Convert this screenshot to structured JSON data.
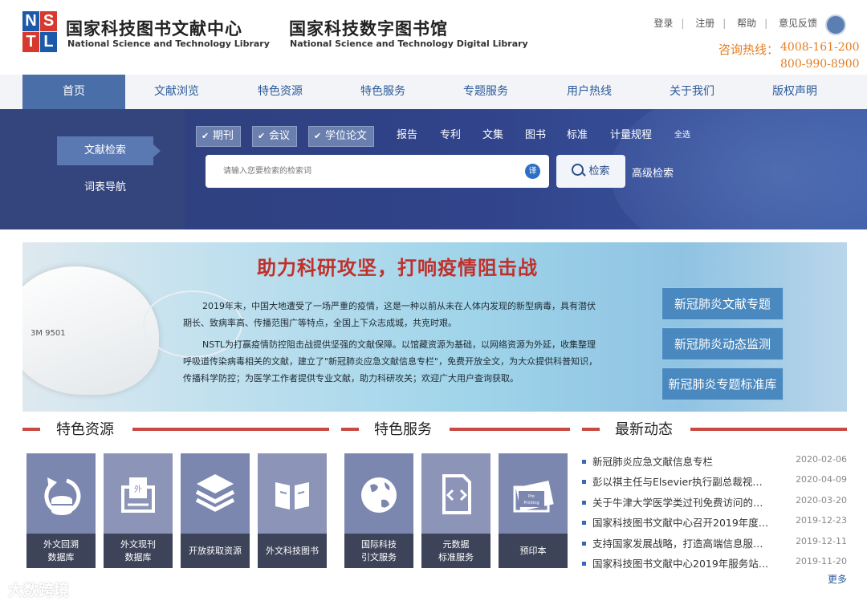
{
  "header": {
    "logo_letters": [
      "N",
      "S",
      "T",
      "L"
    ],
    "title1_cn": "国家科技图书文献中心",
    "title1_en": "National Science and Technology Library",
    "title2_cn": "国家科技数字图书馆",
    "title2_en": "National Science and Technology Digital Library",
    "links": [
      "登录",
      "注册",
      "帮助",
      "意见反馈"
    ],
    "hotline_label": "咨询热线：",
    "hotline_1": "4008-161-200",
    "hotline_2": "800-990-8900",
    "colors": {
      "hotline": "#e67e22",
      "brand_blue": "#2b5a9a",
      "logo_red": "#d63a2f",
      "logo_blue": "#1b5aa8"
    }
  },
  "nav": {
    "items": [
      "首页",
      "文献浏览",
      "特色资源",
      "特色服务",
      "专题服务",
      "用户热线",
      "关于我们",
      "版权声明"
    ],
    "active_index": 0
  },
  "search": {
    "tabs": [
      "文献检索",
      "词表导航"
    ],
    "categories": [
      {
        "label": "期刊",
        "checked": true
      },
      {
        "label": "会议",
        "checked": true
      },
      {
        "label": "学位论文",
        "checked": true
      },
      {
        "label": "报告",
        "checked": false
      },
      {
        "label": "专利",
        "checked": false
      },
      {
        "label": "文集",
        "checked": false
      },
      {
        "label": "图书",
        "checked": false
      },
      {
        "label": "标准",
        "checked": false
      },
      {
        "label": "计量规程",
        "checked": false
      }
    ],
    "select_all": "全选",
    "placeholder": "请输入您要检索的检索词",
    "translate_label": "译",
    "search_button": "检索",
    "advanced": "高级检索"
  },
  "banner": {
    "mask_text": "3M 9501",
    "title": "助力科研攻坚，打响疫情阻击战",
    "para1_line1": "2019年末，中国大地遭受了一场严重的疫情，这是一种以前从未在人体内发现的新型病毒，具有潜伏",
    "para1_line2": "期长、致病率高、传播范围广等特点，全国上下众志成城，共克时艰。",
    "para2_line1": "NSTL为打赢疫情防控阻击战提供坚强的文献保障。以馆藏资源为基础，以网络资源为外延，收集整理",
    "para2_line2": "呼吸道传染病毒相关的文献，建立了\"新冠肺炎应急文献信息专栏\"，免费开放全文，为大众提供科普知识，",
    "para2_line3": "传播科学防控；为医学工作者提供专业文献，助力科研攻关；欢迎广大用户查询获取。",
    "buttons": [
      "新冠肺炎文献专题",
      "新冠肺炎动态监测",
      "新冠肺炎专题标准库"
    ]
  },
  "sections": {
    "resources_title": "特色资源",
    "services_title": "特色服务",
    "news_title": "最新动态"
  },
  "resources": [
    {
      "label": "外文回溯\n数据库",
      "icon": "database-refresh-icon"
    },
    {
      "label": "外文现刊\n数据库",
      "icon": "foreign-journal-icon"
    },
    {
      "label": "开放获取资源",
      "icon": "layers-icon"
    },
    {
      "label": "外文科技图书",
      "icon": "open-book-icon"
    }
  ],
  "services": [
    {
      "label": "国际科技\n引文服务",
      "icon": "globe-icon"
    },
    {
      "label": "元数据\n标准服务",
      "icon": "code-file-icon"
    },
    {
      "label": "预印本",
      "icon": "preprint-icon"
    }
  ],
  "news": [
    {
      "title": "新冠肺炎应急文献信息专栏",
      "date": "2020-02-06"
    },
    {
      "title": "彭以祺主任与Elsevier执行副总裁视…",
      "date": "2020-04-09"
    },
    {
      "title": "关于牛津大学医学类过刊免费访问的…",
      "date": "2020-03-20"
    },
    {
      "title": "国家科技图书文献中心召开2019年度…",
      "date": "2019-12-23"
    },
    {
      "title": "支持国家发展战略，打造高端信息服…",
      "date": "2019-12-11"
    },
    {
      "title": "国家科技图书文献中心2019年服务站…",
      "date": "2019-11-20"
    }
  ],
  "more": "更多",
  "watermark": "大数跨境"
}
